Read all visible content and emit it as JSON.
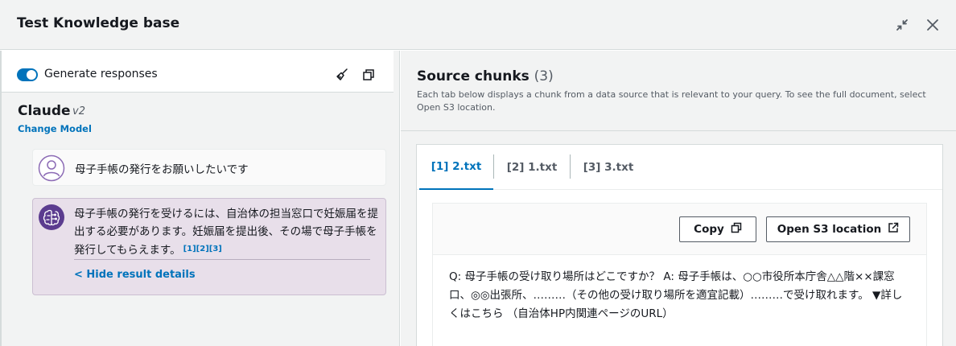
{
  "window": {
    "title": "Test Knowledge base"
  },
  "left_panel": {
    "generate_responses_label": "Generate responses",
    "generate_responses_on": true,
    "model_name": "Claude",
    "model_version": "v2",
    "change_model_label": "Change Model",
    "messages": {
      "user_text": "母子手帳の発行をお願いしたいです",
      "ai_text": "母子手帳の発行を受けるには、自治体の担当窓口で妊娠届を提出する必要があります。妊娠届を提出後、その場で母子手帳を発行してもらえます。",
      "ai_citations": "[1][2][3]",
      "hide_details_label": "< Hide result details"
    }
  },
  "right_panel": {
    "title": "Source chunks",
    "count": "(3)",
    "description": "Each tab below displays a chunk from a data source that is relevant to your query. To see the full document, select Open S3 location.",
    "tabs": [
      {
        "label": "[1] 2.txt",
        "active": true
      },
      {
        "label": "[2] 1.txt",
        "active": false
      },
      {
        "label": "[3] 3.txt",
        "active": false
      }
    ],
    "copy_label": "Copy",
    "open_s3_label": "Open S3 location",
    "chunk_text": "Q: 母子手帳の受け取り場所はどこですか？ A: 母子手帳は、○○市役所本庁舎△△階××課窓口、◎◎出張所、………（その他の受け取り場所を適宜記載）………で受け取れます。 ▼詳しくはこちら （自治体HP内関連ページのURL）"
  },
  "colors": {
    "accent": "#0073bb",
    "ai_bubble": "#e8dfea",
    "ai_avatar": "#5b3c8f",
    "user_avatar": "#8c6bb5"
  }
}
